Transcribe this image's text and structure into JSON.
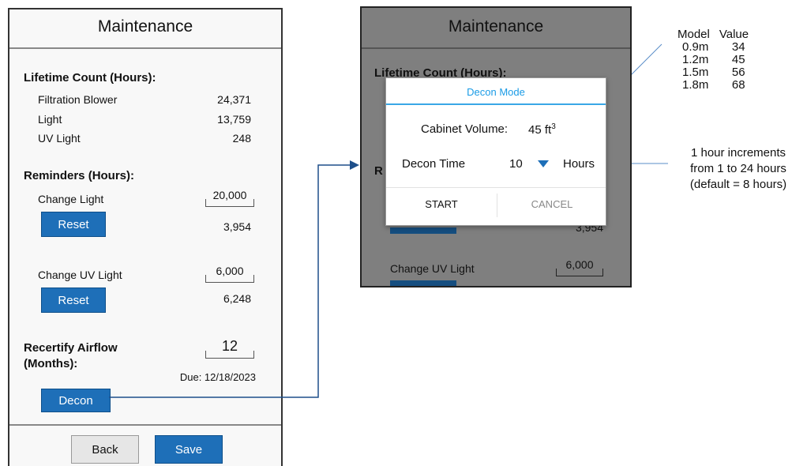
{
  "left": {
    "title": "Maintenance",
    "lifetime_header": "Lifetime Count (Hours):",
    "lifetime_rows": [
      {
        "label": "Filtration Blower",
        "value": "24,371"
      },
      {
        "label": "Light",
        "value": "13,759"
      },
      {
        "label": "UV Light",
        "value": "248"
      }
    ],
    "reminders_header": "Reminders (Hours):",
    "change_light_label": "Change Light",
    "change_light_setting": "20,000",
    "change_light_reset": "Reset",
    "change_light_current": "3,954",
    "change_uv_label": "Change UV Light",
    "change_uv_setting": "6,000",
    "change_uv_reset": "Reset",
    "change_uv_current": "6,248",
    "recertify_label_line1": "Recertify Airflow",
    "recertify_label_line2": "(Months):",
    "recertify_months": "12",
    "due_text": "Due: 12/18/2023",
    "decon_button": "Decon",
    "back_button": "Back",
    "save_button": "Save"
  },
  "right": {
    "title": "Maintenance",
    "lifetime_header_partial": "Lifetime Count (Hours):",
    "reminders_partial": "R",
    "change_uv_label": "Change UV Light",
    "change_uv_setting": "6,000",
    "obscured_value": "3,954"
  },
  "dialog": {
    "title": "Decon Mode",
    "cabinet_volume_label": "Cabinet Volume:",
    "cabinet_volume_value": "45 ft",
    "cabinet_volume_unit_sup": "3",
    "decon_time_label": "Decon Time",
    "decon_time_value": "10",
    "decon_time_unit": "Hours",
    "start_button": "START",
    "cancel_button": "CANCEL"
  },
  "annotations": {
    "table_headers": [
      "Model",
      "Value"
    ],
    "table_rows": [
      [
        "0.9m",
        "34"
      ],
      [
        "1.2m",
        "45"
      ],
      [
        "1.5m",
        "56"
      ],
      [
        "1.8m",
        "68"
      ]
    ],
    "increments_note": [
      "1 hour increments",
      "from 1 to 24 hours",
      "(default = 8 hours)"
    ]
  },
  "colors": {
    "accent_blue": "#1e6fb8",
    "dialog_title_blue": "#1a9be6",
    "dim_overlay": "#7f7f7f"
  },
  "icons": {
    "dropdown": "triangle-down-icon"
  }
}
